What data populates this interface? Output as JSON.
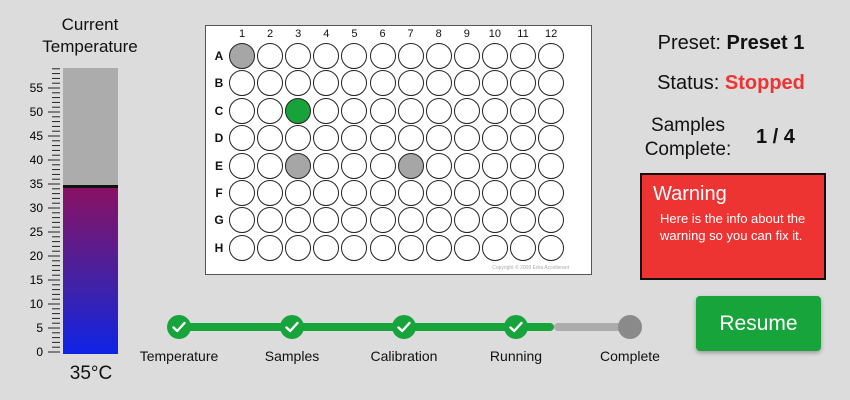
{
  "thermometer": {
    "title_line1": "Current",
    "title_line2": "Temperature",
    "value": 35,
    "readout": "35°C",
    "scale_min": 0,
    "scale_max": 59,
    "major_ticks": [
      "0",
      "5",
      "10",
      "15",
      "20",
      "25",
      "30",
      "35",
      "40",
      "45",
      "50",
      "55"
    ]
  },
  "plate": {
    "columns": [
      "1",
      "2",
      "3",
      "4",
      "5",
      "6",
      "7",
      "8",
      "9",
      "10",
      "11",
      "12"
    ],
    "rows": [
      "A",
      "B",
      "C",
      "D",
      "E",
      "F",
      "G",
      "H"
    ],
    "highlighted_wells": [
      {
        "well": "A1",
        "color": "gray"
      },
      {
        "well": "C3",
        "color": "green"
      },
      {
        "well": "E3",
        "color": "gray"
      },
      {
        "well": "E7",
        "color": "gray"
      }
    ],
    "copyright": "Copyright © 2009 Edra Accellerant"
  },
  "status_panel": {
    "preset_label": "Preset:",
    "preset_value": "Preset 1",
    "status_label": "Status:",
    "status_value": "Stopped",
    "samples_label_line1": "Samples",
    "samples_label_line2": "Complete:",
    "samples_value": "1 / 4"
  },
  "warning": {
    "title": "Warning",
    "message": "Here is the info about the warning so you can fix it."
  },
  "resume_button": {
    "label": "Resume"
  },
  "progress": {
    "steps": [
      {
        "label": "Temperature",
        "done": true
      },
      {
        "label": "Samples",
        "done": true
      },
      {
        "label": "Calibration",
        "done": true
      },
      {
        "label": "Running",
        "done": true
      },
      {
        "label": "Complete",
        "done": false
      }
    ]
  },
  "colors": {
    "accent_green": "#17a43b",
    "status_red": "#ee3333",
    "track_gray": "#acacac"
  }
}
